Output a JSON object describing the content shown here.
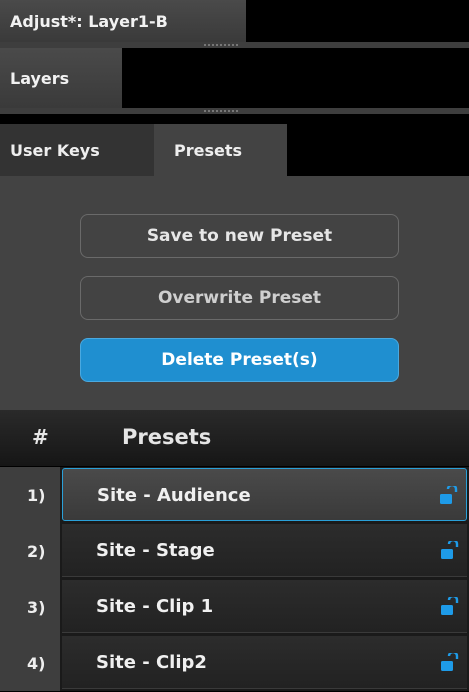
{
  "title_tab": {
    "label": "Adjust*: Layer1-B"
  },
  "layers_tab": {
    "label": "Layers"
  },
  "panel_tabs": [
    {
      "label": "User Keys",
      "active": false
    },
    {
      "label": "Presets",
      "active": true
    }
  ],
  "actions": {
    "save_label": "Save to new Preset",
    "overwrite_label": "Overwrite Preset",
    "delete_label": "Delete Preset(s)"
  },
  "table": {
    "columns": [
      "#",
      "Presets"
    ],
    "rows": [
      {
        "num": "1)",
        "name": "Site - Audience",
        "selected": true,
        "icon": "unlock-icon"
      },
      {
        "num": "2)",
        "name": "Site - Stage",
        "selected": false,
        "icon": "unlock-icon"
      },
      {
        "num": "3)",
        "name": "Site - Clip 1",
        "selected": false,
        "icon": "unlock-icon"
      },
      {
        "num": "4)",
        "name": "Site - Clip2",
        "selected": false,
        "icon": "unlock-icon"
      }
    ]
  },
  "colors": {
    "accent": "#1f8fd0",
    "icon_blue": "#1e9be8"
  }
}
